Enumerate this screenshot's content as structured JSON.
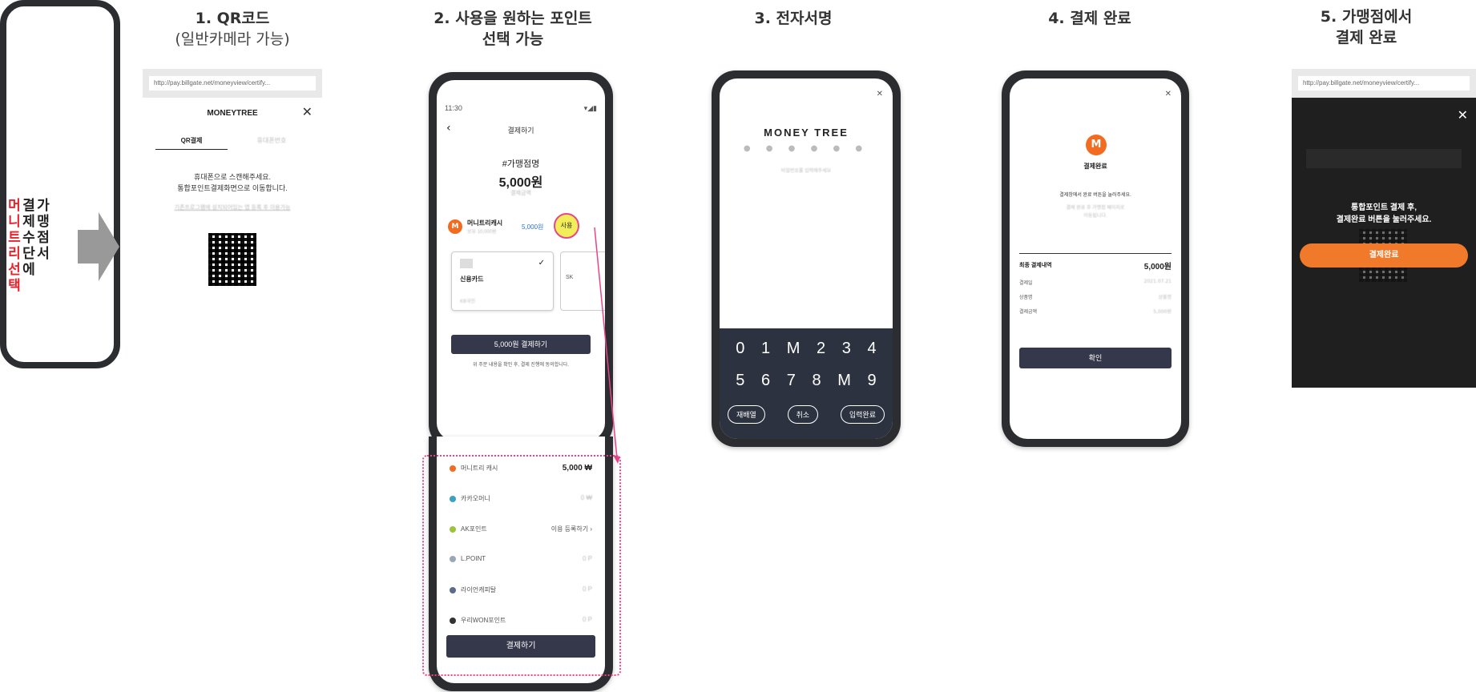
{
  "left": {
    "vertical_col1": [
      "머",
      "니",
      "트",
      "리",
      "선",
      "택"
    ],
    "vertical_col2": [
      "결",
      "제",
      "수",
      "단",
      "에"
    ],
    "vertical_col3": [
      "가",
      "맹",
      "점",
      "",
      "서"
    ]
  },
  "steps": [
    {
      "title": "1. QR코드",
      "subtitle": "(일반카메라 가능)"
    },
    {
      "title": "2. 사용을 원하는 포인트",
      "subtitle": "선택 가능"
    },
    {
      "title": "3. 전자서명",
      "subtitle": ""
    },
    {
      "title": "4. 결제 완료",
      "subtitle": ""
    },
    {
      "title": "5. 가맹점에서",
      "subtitle": "결제 완료"
    }
  ],
  "step1": {
    "url": "http://pay.billgate.net/moneyview/certify...",
    "brand": "MONEYTREE",
    "close": "✕",
    "tab_active": "QR결제",
    "tab_inactive": "휴대폰번호",
    "instruction1": "휴대폰으로 스캔해주세요.",
    "instruction2": "통합포인트결제화면으로 이동합니다.",
    "note": "기존프로그램에 설치되어있는 앱 등록 후 이용가능"
  },
  "step2": {
    "status_time": "11:30",
    "header": "결제하기",
    "merchant": "#가맹점명",
    "amount": "5,000원",
    "amount_sub": "결제금액",
    "point_name": "머니트리캐시",
    "point_sub": "보유 10,000원",
    "point_value": "5,000원",
    "use_btn": "사용",
    "card_label": "신용카드",
    "card_sub": "KB국민",
    "card2_label": "SK",
    "pay_btn": "5,000원 결제하기",
    "agree_text": "위 주문 내용을 확인 후, 결제 진행에 동의합니다.",
    "list": [
      {
        "name": "머니트리 캐시",
        "value": "5,000 ₩",
        "color": "#f26b21"
      },
      {
        "name": "카카오머니",
        "value": "0 ₩",
        "color": "#3aa0c8"
      },
      {
        "name": "AK포인트",
        "value": "이용 등록하기 ›",
        "color": "#9bc43a"
      },
      {
        "name": "L.POINT",
        "value": "0 P",
        "color": "#9aa7b8"
      },
      {
        "name": "라이언캐피탈",
        "value": "0 P",
        "color": "#5b6b8c"
      },
      {
        "name": "우리WON포인트",
        "value": "0 P",
        "color": "#333333"
      }
    ],
    "bottom_btn": "결제하기"
  },
  "step3": {
    "brand": "MONEY TREE",
    "placeholder": "비밀번호를 입력해주세요",
    "close": "✕",
    "keys_row1": [
      "0",
      "1",
      "M",
      "2",
      "3",
      "4"
    ],
    "keys_row2": [
      "5",
      "6",
      "7",
      "8",
      "M",
      "9"
    ],
    "btn_rearrange": "재배열",
    "btn_cancel": "취소",
    "btn_done": "입력완료"
  },
  "step4": {
    "close": "✕",
    "logo": "M",
    "title": "결제완료",
    "msg1": "결제창에서 완료 버튼을 눌러주세요.",
    "msg2": "결제 완료 후 가맹점 페이지로",
    "msg3": "이동됩니다.",
    "summary_label": "최종 결제내역",
    "summary_value": "5,000원",
    "rows": [
      {
        "label": "결제일",
        "value": "2021.07.21"
      },
      {
        "label": "상품명",
        "value": "상품명"
      },
      {
        "label": "결제금액",
        "value": "5,000원"
      }
    ],
    "confirm": "확인"
  },
  "step5": {
    "url": "http://pay.billgate.net/moneyview/certify...",
    "close": "✕",
    "msg1": "통합포인트 결제 후,",
    "msg2": "결제완료 버튼을 눌러주세요.",
    "btn": "결제완료"
  }
}
